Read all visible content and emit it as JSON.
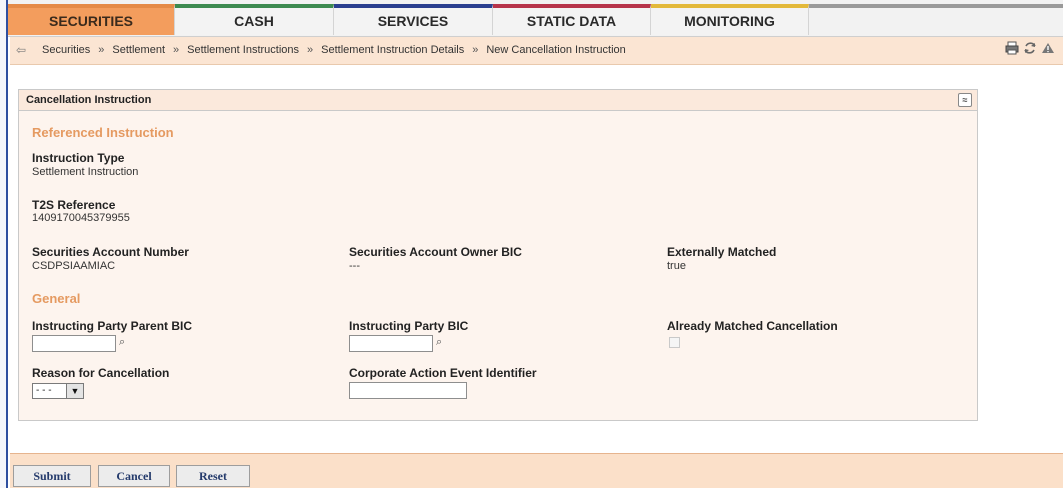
{
  "tabs": [
    {
      "label": "SECURITIES",
      "color": "#e58a47",
      "active": true
    },
    {
      "label": "CASH",
      "color": "#3d8a50"
    },
    {
      "label": "SERVICES",
      "color": "#2a3f8f"
    },
    {
      "label": "STATIC DATA",
      "color": "#b7344a"
    },
    {
      "label": "MONITORING",
      "color": "#e3b93a"
    }
  ],
  "breadcrumb": {
    "back_icon": "back-arrow-icon",
    "items": [
      "Securities",
      "Settlement",
      "Settlement Instructions",
      "Settlement Instruction Details",
      "New Cancellation Instruction"
    ],
    "separator": "»"
  },
  "toolbar_icons": [
    "print-icon",
    "refresh-icon",
    "alert-icon"
  ],
  "panel": {
    "title": "Cancellation Instruction",
    "referenced": {
      "heading": "Referenced Instruction",
      "instruction_type_label": "Instruction Type",
      "instruction_type_value": "Settlement Instruction",
      "t2s_label": "T2S Reference",
      "t2s_value": "1409170045379955",
      "account_number_label": "Securities Account Number",
      "account_number_value": "CSDPSIAAMIAC",
      "owner_bic_label": "Securities Account Owner BIC",
      "owner_bic_value": "---",
      "externally_matched_label": "Externally Matched",
      "externally_matched_value": "true"
    },
    "general": {
      "heading": "General",
      "parent_bic_label": "Instructing Party Parent BIC",
      "parent_bic_value": "",
      "party_bic_label": "Instructing Party BIC",
      "party_bic_value": "",
      "already_matched_label": "Already Matched Cancellation",
      "already_matched_checked": false,
      "reason_label": "Reason for Cancellation",
      "reason_selected": "- - -",
      "ca_event_label": "Corporate Action Event Identifier",
      "ca_event_value": ""
    }
  },
  "buttons": {
    "submit": "Submit",
    "cancel": "Cancel",
    "reset": "Reset"
  }
}
